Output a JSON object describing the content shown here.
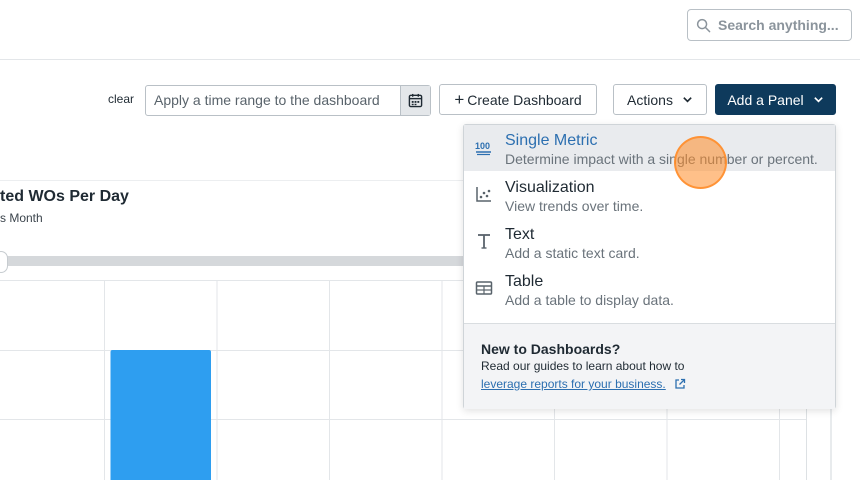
{
  "header": {
    "search_placeholder": "Search anything..."
  },
  "toolbar": {
    "clear_label": "clear",
    "time_range_placeholder": "Apply a time range to the dashboard",
    "create_dashboard_label": "Create Dashboard",
    "actions_label": "Actions",
    "add_panel_label": "Add a Panel"
  },
  "chart_card": {
    "title": "ted WOs Per Day",
    "subtitle": "s Month"
  },
  "chart_data": {
    "type": "bar",
    "categories": [
      "",
      "",
      "",
      "",
      "",
      "",
      "",
      ""
    ],
    "values": [
      null,
      1,
      null,
      null,
      null,
      null,
      null,
      null
    ],
    "title": "ted WOs Per Day",
    "xlabel": "",
    "ylabel": "",
    "color": "#2e9ef0"
  },
  "add_panel_menu": {
    "items": [
      {
        "title": "Single Metric",
        "description": "Determine impact with a single number or percent.",
        "icon": "hundred-points-icon"
      },
      {
        "title": "Visualization",
        "description": "View trends over time.",
        "icon": "chart-icon"
      },
      {
        "title": "Text",
        "description": "Add a static text card.",
        "icon": "text-icon"
      },
      {
        "title": "Table",
        "description": "Add a table to display data.",
        "icon": "table-icon"
      }
    ],
    "footer": {
      "title": "New to Dashboards?",
      "text": "Read our guides to learn about how to",
      "link": "leverage reports for your business."
    }
  },
  "colors": {
    "primary_button": "#0e3a5c",
    "accent_link": "#2c6fb0",
    "bar": "#2e9ef0",
    "cursor": "#ff8c28"
  }
}
